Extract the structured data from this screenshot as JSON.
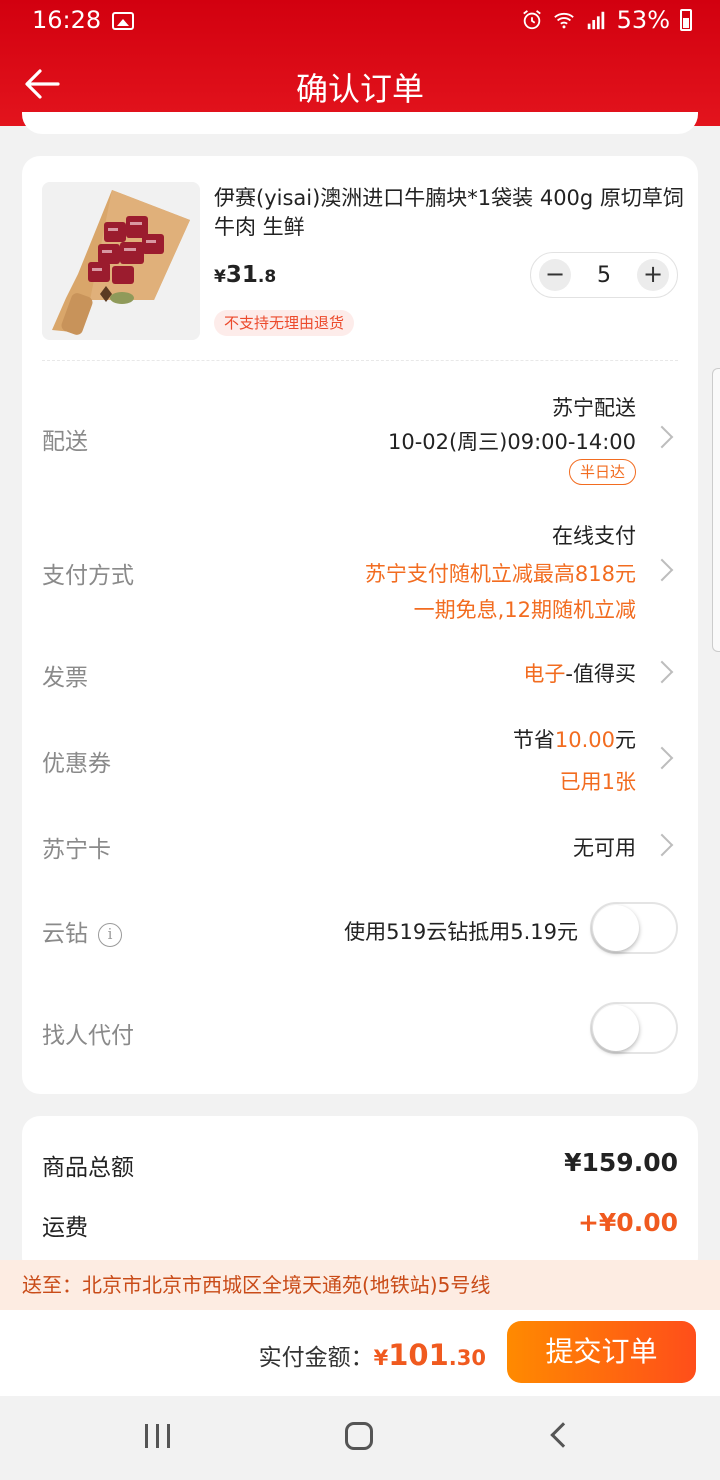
{
  "status_bar": {
    "time": "16:28",
    "network": "4G",
    "battery": "53%"
  },
  "header": {
    "title": "确认订单"
  },
  "product": {
    "name": "伊赛(yisai)澳洲进口牛腩块*1袋装 400g 原切草饲牛肉 生鲜",
    "price_currency": "¥",
    "price_int": "31",
    "price_dec": ".8",
    "quantity": "5",
    "minus": "−",
    "plus": "+",
    "return_tag": "不支持无理由退货"
  },
  "delivery": {
    "label": "配送",
    "carrier": "苏宁配送",
    "time": "10-02(周三)09:00-14:00",
    "badge": "半日达"
  },
  "payment": {
    "label": "支付方式",
    "method": "在线支付",
    "promo1": "苏宁支付随机立减最高818元",
    "promo2": "一期免息,12期随机立减"
  },
  "invoice": {
    "label": "发票",
    "type": "电子",
    "title": "-值得买"
  },
  "coupon": {
    "label": "优惠券",
    "prefix": "节省",
    "amount": "10.00",
    "suffix": "元",
    "used": "已用1张"
  },
  "suning_card": {
    "label": "苏宁卡",
    "value": "无可用"
  },
  "cloud_diamond": {
    "label": "云钻",
    "info": "i",
    "text": "使用519云钻抵用5.19元",
    "enabled": false
  },
  "proxy_pay": {
    "label": "找人代付",
    "enabled": false
  },
  "summary": {
    "goods_label": "商品总额",
    "goods_value": "¥159.00",
    "shipping_label": "运费",
    "shipping_value": "+¥0.00"
  },
  "address": "送至：北京市北京市西城区全境天通苑(地铁站)5号线",
  "checkout": {
    "pay_label": "实付金额：",
    "currency": "¥",
    "amount_int": "101",
    "amount_dec": ".30",
    "submit": "提交订单"
  },
  "colors": {
    "header_red": "#d2000f",
    "accent_orange": "#f26c20",
    "submit_gradient_start": "#ff8a00",
    "submit_gradient_end": "#ff4e1a"
  }
}
